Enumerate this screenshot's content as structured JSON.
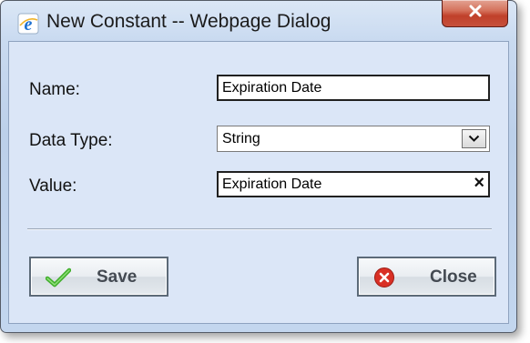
{
  "dialog": {
    "title": "New Constant -- Webpage Dialog",
    "titlebar_icon": "ie-icon",
    "close_icon": "close-x-icon"
  },
  "form": {
    "name_label": "Name:",
    "name_value": "Expiration Date",
    "datatype_label": "Data Type:",
    "datatype_value": "String",
    "value_label": "Value:",
    "value_value": "Expiration Date",
    "clear_glyph": "×"
  },
  "buttons": {
    "save_label": "Save",
    "close_label": "Close"
  },
  "colors": {
    "save_check": "#3fae2a",
    "close_circle": "#d93025",
    "titlebar_close": "#c7432d"
  }
}
